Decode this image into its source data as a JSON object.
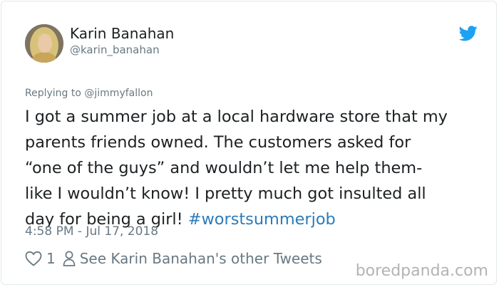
{
  "tweet": {
    "author_name": "Karin Banahan",
    "author_handle": "@karin_banahan",
    "replying_prefix": "Replying to ",
    "replying_to": "@jimmyfallon",
    "text_lines": [
      "I got a summer job at a local hardware store that my",
      "parents friends owned. The customers asked for",
      "“one of the guys” and wouldn’t let me help them-",
      "like I wouldn’t know! I pretty much got insulted all",
      "day for being a girl! "
    ],
    "hashtag": "#worstsummerjob",
    "timestamp": "4:58 PM - Jul 17, 2018",
    "like_count": "1",
    "other_tweets_label": "See Karin Banahan's other Tweets"
  },
  "watermark": "boredpanda.com",
  "icons": {
    "brand": "twitter-bird-icon",
    "like": "heart-icon",
    "profile": "person-icon"
  },
  "colors": {
    "twitter_blue": "#1da1f2",
    "hashtag": "#2b7bb9",
    "muted": "#697882",
    "text": "#1c2022",
    "border": "#e1e8ed"
  }
}
